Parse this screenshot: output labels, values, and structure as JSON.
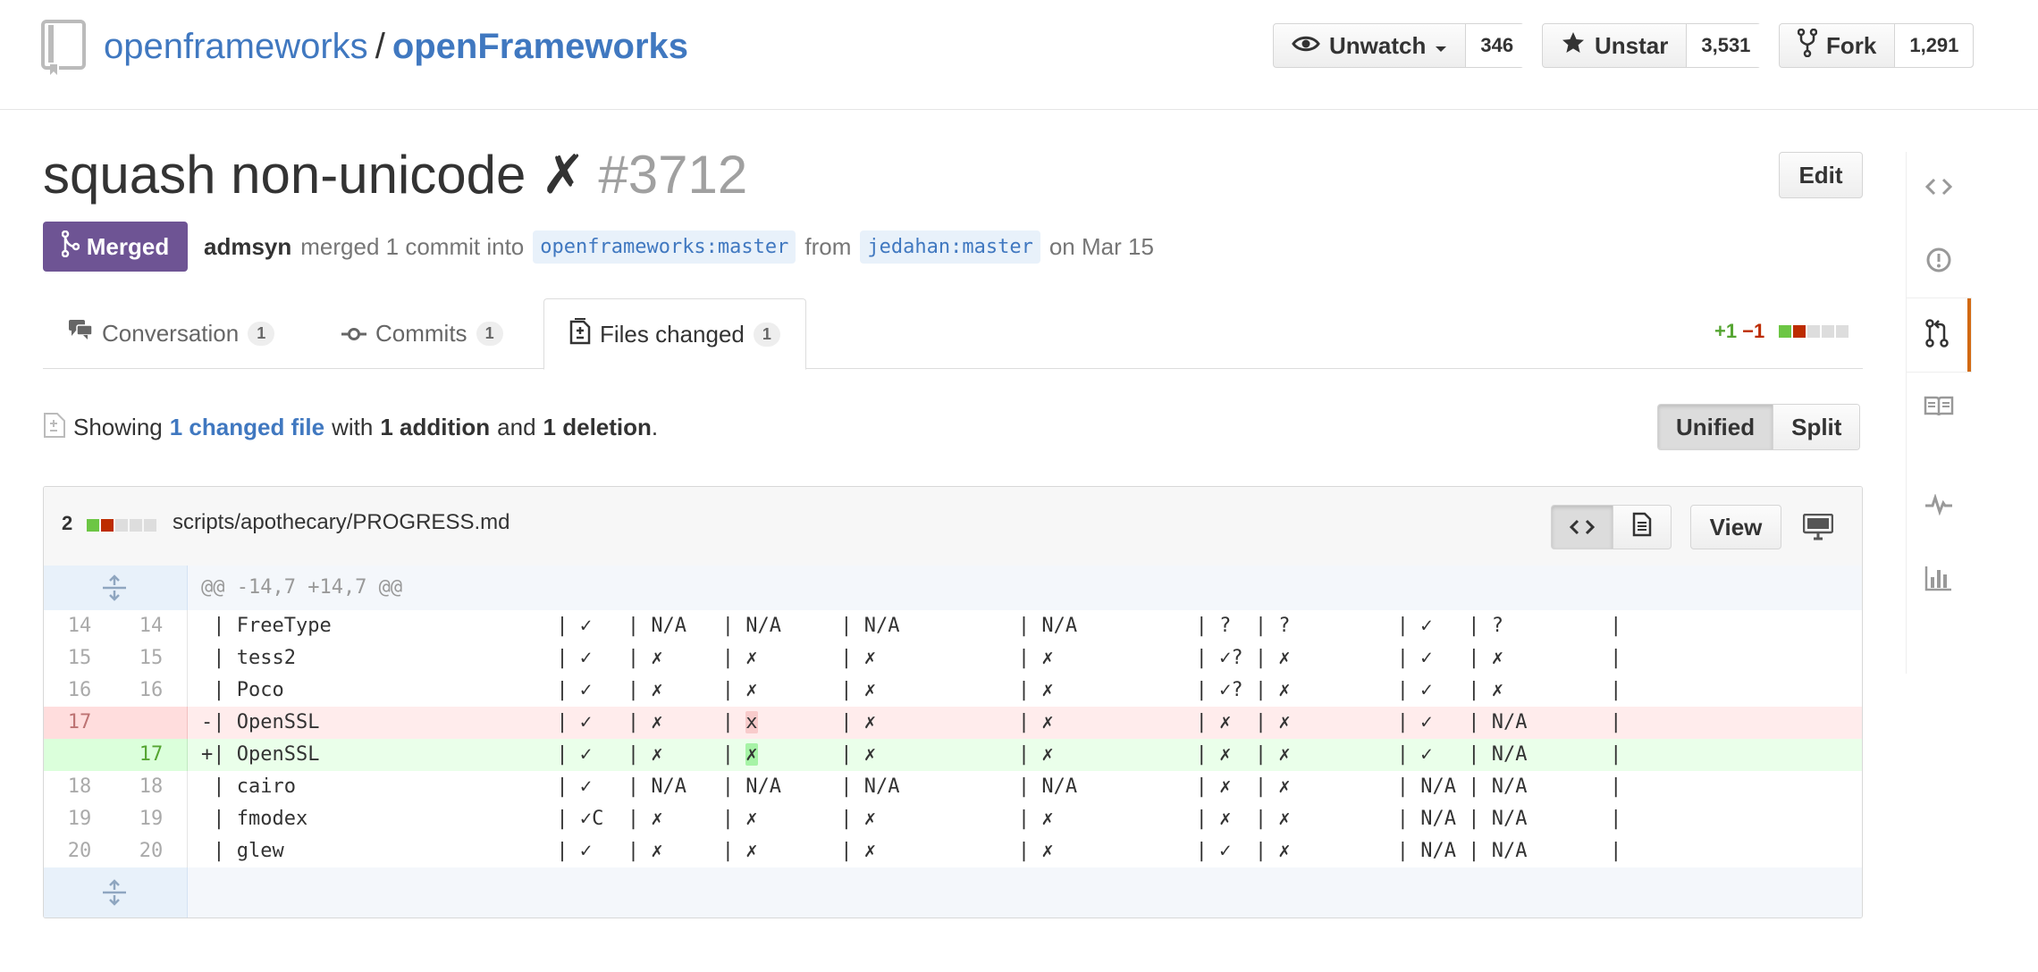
{
  "repo": {
    "owner": "openframeworks",
    "separator": "/",
    "name": "openFrameworks"
  },
  "header_actions": {
    "watch": {
      "label": "Unwatch",
      "count": "346"
    },
    "star": {
      "label": "Unstar",
      "count": "3,531"
    },
    "fork": {
      "label": "Fork",
      "count": "1,291"
    }
  },
  "pull_request": {
    "title": "squash non-unicode ✗",
    "number": "#3712",
    "edit_label": "Edit",
    "state": "Merged",
    "author": "admsyn",
    "action": "merged 1 commit into",
    "base_branch": "openframeworks:master",
    "from_word": "from",
    "head_branch": "jedahan:master",
    "date_text": "on Mar 15"
  },
  "tabs": [
    {
      "label": "Conversation",
      "count": "1"
    },
    {
      "label": "Commits",
      "count": "1"
    },
    {
      "label": "Files changed",
      "count": "1"
    }
  ],
  "diffstat": {
    "additions": "+1",
    "deletions": "−1"
  },
  "summary": {
    "showing": "Showing",
    "changed_files": "1 changed file",
    "with": "with",
    "additions": "1 addition",
    "and": "and",
    "deletions": "1 deletion",
    "period": "."
  },
  "view_toggle": {
    "unified": "Unified",
    "split": "Split"
  },
  "file": {
    "changes": "2",
    "path": "scripts/apothecary/PROGRESS.md",
    "view_label": "View",
    "hunk_header": "@@ -14,7 +14,7 @@",
    "lines": [
      {
        "type": "context",
        "old": "14",
        "new": "14",
        "text": " | FreeType                   | ✓   | N/A   | N/A     | N/A          | N/A          | ?  | ?         | ✓   | ?         |"
      },
      {
        "type": "context",
        "old": "15",
        "new": "15",
        "text": " | tess2                      | ✓   | ✗     | ✗       | ✗            | ✗            | ✓? | ✗         | ✓   | ✗         |"
      },
      {
        "type": "context",
        "old": "16",
        "new": "16",
        "text": " | Poco                       | ✓   | ✗     | ✗       | ✗            | ✗            | ✓? | ✗         | ✓   | ✗         |"
      },
      {
        "type": "deleted",
        "old": "17",
        "new": "",
        "text_pre": "-| OpenSSL                    | ✓   | ✗     | ",
        "text_hl": "x",
        "text_post": "       | ✗            | ✗            | ✗  | ✗         | ✓   | N/A       |"
      },
      {
        "type": "added",
        "old": "",
        "new": "17",
        "text_pre": "+| OpenSSL                    | ✓   | ✗     | ",
        "text_hl": "✗",
        "text_post": "       | ✗            | ✗            | ✗  | ✗         | ✓   | N/A       |"
      },
      {
        "type": "context",
        "old": "18",
        "new": "18",
        "text": " | cairo                      | ✓   | N/A   | N/A     | N/A          | N/A          | ✗  | ✗         | N/A | N/A       |"
      },
      {
        "type": "context",
        "old": "19",
        "new": "19",
        "text": " | fmodex                     | ✓C  | ✗     | ✗       | ✗            | ✗            | ✗  | ✗         | N/A | N/A       |"
      },
      {
        "type": "context",
        "old": "20",
        "new": "20",
        "text": " | glew                       | ✓   | ✗     | ✗       | ✗            | ✗            | ✓  | ✗         | N/A | N/A       |"
      }
    ]
  },
  "colors": {
    "link": "#4078c0",
    "merged": "#6e5494",
    "addition": "#55a532",
    "deletion": "#bd2c00",
    "rail_selected": "#d26911"
  },
  "icons": [
    "repo-icon",
    "eye-icon",
    "star-icon",
    "fork-icon",
    "git-merge-icon",
    "comment-icon",
    "commit-icon",
    "file-diff-icon",
    "code-icon",
    "file-text-icon",
    "desktop-icon",
    "expand-icon",
    "issue-icon",
    "pull-request-icon",
    "book-icon",
    "pulse-icon",
    "graph-icon"
  ]
}
